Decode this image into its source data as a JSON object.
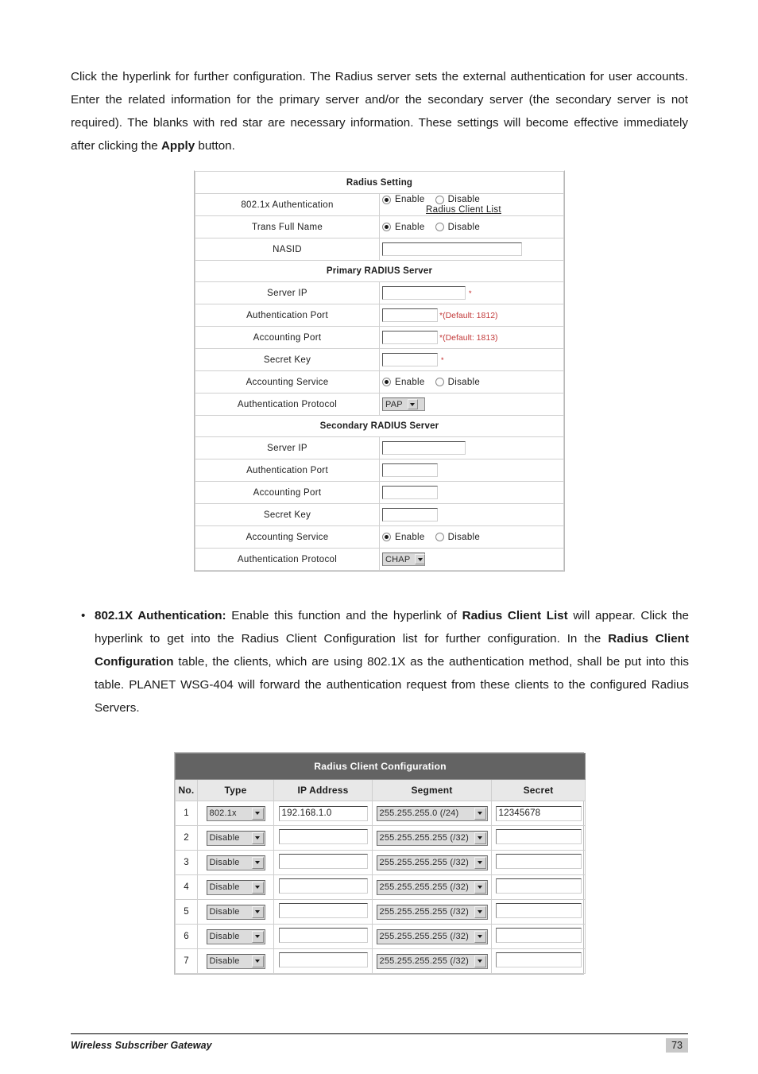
{
  "intro_paragraph": {
    "part1": "Click the hyperlink for further configuration. The Radius server sets the external authentication for user accounts. Enter the related information for the primary server and/or the secondary server (the secondary server is not required). The blanks with red star are necessary information. These settings will become effective immediately after clicking the ",
    "apply_bold": "Apply",
    "part2": " button."
  },
  "radius_setting": {
    "title": "Radius Setting",
    "rows": {
      "dot1x_auth_label": "802.1x Authentication",
      "enable_label": "Enable",
      "disable_label": "Disable",
      "radius_client_list_link": "Radius Client List",
      "trans_full_name_label": "Trans Full Name",
      "nasid_label": "NASID",
      "nasid_value": ""
    },
    "primary": {
      "heading": "Primary RADIUS Server",
      "server_ip_label": "Server IP",
      "server_ip_value": "",
      "server_ip_star": "*",
      "auth_port_label": "Authentication Port",
      "auth_port_value": "",
      "auth_port_note": "*(Default: 1812)",
      "acct_port_label": "Accounting Port",
      "acct_port_value": "",
      "acct_port_note": "*(Default: 1813)",
      "secret_key_label": "Secret Key",
      "secret_key_value": "",
      "secret_key_star": "*",
      "acct_service_label": "Accounting Service",
      "enable_label": "Enable",
      "disable_label": "Disable",
      "auth_protocol_label": "Authentication Protocol",
      "auth_protocol_value": "PAP"
    },
    "secondary": {
      "heading": "Secondary RADIUS Server",
      "server_ip_label": "Server IP",
      "server_ip_value": "",
      "auth_port_label": "Authentication Port",
      "auth_port_value": "",
      "acct_port_label": "Accounting Port",
      "acct_port_value": "",
      "secret_key_label": "Secret Key",
      "secret_key_value": "",
      "acct_service_label": "Accounting Service",
      "enable_label": "Enable",
      "disable_label": "Disable",
      "auth_protocol_label": "Authentication Protocol",
      "auth_protocol_value": "CHAP"
    }
  },
  "auth_bullet": {
    "term": "802.1X Authentication:",
    "text1": " Enable this function and the hyperlink of ",
    "bold1": "Radius Client List",
    "text2": " will appear. Click the hyperlink to get into the Radius Client Configuration list for further configuration. In the ",
    "bold2": "Radius Client Configuration",
    "text3": " table, the clients, which are using 802.1X as the authentication method, shall be put into this table. PLANET WSG-404 will forward the authentication request from these clients to the configured Radius Servers."
  },
  "radius_client_config": {
    "title": "Radius Client Configuration",
    "columns": [
      "No.",
      "Type",
      "IP Address",
      "Segment",
      "Secret"
    ],
    "rows": [
      {
        "no": "1",
        "type": "802.1x",
        "ip": "192.168.1.0",
        "segment": "255.255.255.0 (/24)",
        "secret": "12345678"
      },
      {
        "no": "2",
        "type": "Disable",
        "ip": "",
        "segment": "255.255.255.255 (/32)",
        "secret": ""
      },
      {
        "no": "3",
        "type": "Disable",
        "ip": "",
        "segment": "255.255.255.255 (/32)",
        "secret": ""
      },
      {
        "no": "4",
        "type": "Disable",
        "ip": "",
        "segment": "255.255.255.255 (/32)",
        "secret": ""
      },
      {
        "no": "5",
        "type": "Disable",
        "ip": "",
        "segment": "255.255.255.255 (/32)",
        "secret": ""
      },
      {
        "no": "6",
        "type": "Disable",
        "ip": "",
        "segment": "255.255.255.255 (/32)",
        "secret": ""
      },
      {
        "no": "7",
        "type": "Disable",
        "ip": "",
        "segment": "255.255.255.255 (/32)",
        "secret": ""
      }
    ]
  },
  "footer": {
    "title": "Wireless Subscriber Gateway",
    "page_number": "73"
  },
  "colors": {
    "table_header_dark": "#636363",
    "column_header_gray": "#e8e8e8",
    "required_red": "#c33a3a"
  }
}
